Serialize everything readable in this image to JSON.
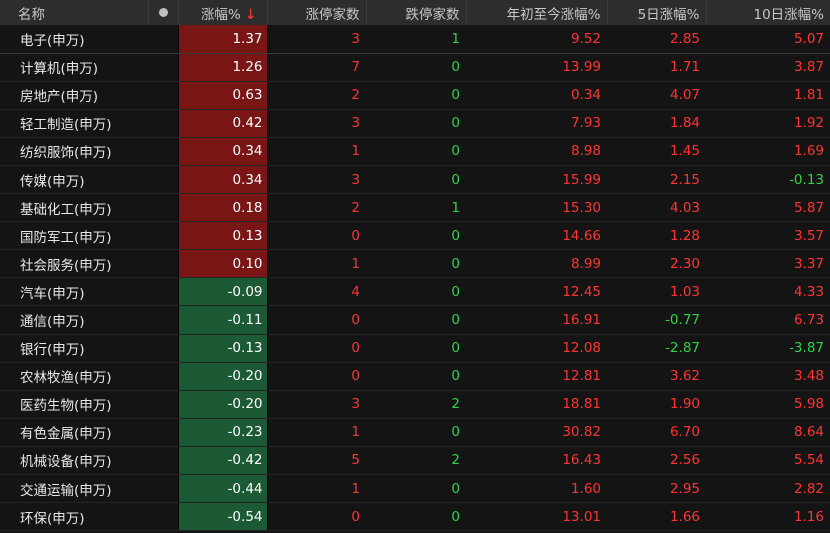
{
  "header": {
    "name": "名称",
    "change": "涨幅%",
    "sort_arrow": "↓",
    "limit_up": "涨停家数",
    "limit_down": "跌停家数",
    "ytd": "年初至今涨幅%",
    "d5": "5日涨幅%",
    "d10": "10日涨幅%"
  },
  "colors": {
    "up": "#ff3333",
    "down": "#2fd14a",
    "up_bg": "#7a1515",
    "down_bg": "#1c5a35"
  },
  "rows": [
    {
      "name": "电子(申万)",
      "change": "1.37",
      "limit_up": "3",
      "limit_down": "1",
      "ytd": "9.52",
      "d5": "2.85",
      "d10": "5.07"
    },
    {
      "name": "计算机(申万)",
      "change": "1.26",
      "limit_up": "7",
      "limit_down": "0",
      "ytd": "13.99",
      "d5": "1.71",
      "d10": "3.87"
    },
    {
      "name": "房地产(申万)",
      "change": "0.63",
      "limit_up": "2",
      "limit_down": "0",
      "ytd": "0.34",
      "d5": "4.07",
      "d10": "1.81"
    },
    {
      "name": "轻工制造(申万)",
      "change": "0.42",
      "limit_up": "3",
      "limit_down": "0",
      "ytd": "7.93",
      "d5": "1.84",
      "d10": "1.92"
    },
    {
      "name": "纺织服饰(申万)",
      "change": "0.34",
      "limit_up": "1",
      "limit_down": "0",
      "ytd": "8.98",
      "d5": "1.45",
      "d10": "1.69"
    },
    {
      "name": "传媒(申万)",
      "change": "0.34",
      "limit_up": "3",
      "limit_down": "0",
      "ytd": "15.99",
      "d5": "2.15",
      "d10": "-0.13"
    },
    {
      "name": "基础化工(申万)",
      "change": "0.18",
      "limit_up": "2",
      "limit_down": "1",
      "ytd": "15.30",
      "d5": "4.03",
      "d10": "5.87"
    },
    {
      "name": "国防军工(申万)",
      "change": "0.13",
      "limit_up": "0",
      "limit_down": "0",
      "ytd": "14.66",
      "d5": "1.28",
      "d10": "3.57"
    },
    {
      "name": "社会服务(申万)",
      "change": "0.10",
      "limit_up": "1",
      "limit_down": "0",
      "ytd": "8.99",
      "d5": "2.30",
      "d10": "3.37"
    },
    {
      "name": "汽车(申万)",
      "change": "-0.09",
      "limit_up": "4",
      "limit_down": "0",
      "ytd": "12.45",
      "d5": "1.03",
      "d10": "4.33"
    },
    {
      "name": "通信(申万)",
      "change": "-0.11",
      "limit_up": "0",
      "limit_down": "0",
      "ytd": "16.91",
      "d5": "-0.77",
      "d10": "6.73"
    },
    {
      "name": "银行(申万)",
      "change": "-0.13",
      "limit_up": "0",
      "limit_down": "0",
      "ytd": "12.08",
      "d5": "-2.87",
      "d10": "-3.87"
    },
    {
      "name": "农林牧渔(申万)",
      "change": "-0.20",
      "limit_up": "0",
      "limit_down": "0",
      "ytd": "12.81",
      "d5": "3.62",
      "d10": "3.48"
    },
    {
      "name": "医药生物(申万)",
      "change": "-0.20",
      "limit_up": "3",
      "limit_down": "2",
      "ytd": "18.81",
      "d5": "1.90",
      "d10": "5.98"
    },
    {
      "name": "有色金属(申万)",
      "change": "-0.23",
      "limit_up": "1",
      "limit_down": "0",
      "ytd": "30.82",
      "d5": "6.70",
      "d10": "8.64"
    },
    {
      "name": "机械设备(申万)",
      "change": "-0.42",
      "limit_up": "5",
      "limit_down": "2",
      "ytd": "16.43",
      "d5": "2.56",
      "d10": "5.54"
    },
    {
      "name": "交通运输(申万)",
      "change": "-0.44",
      "limit_up": "1",
      "limit_down": "0",
      "ytd": "1.60",
      "d5": "2.95",
      "d10": "2.82"
    },
    {
      "name": "环保(申万)",
      "change": "-0.54",
      "limit_up": "0",
      "limit_down": "0",
      "ytd": "13.01",
      "d5": "1.66",
      "d10": "1.16"
    }
  ]
}
